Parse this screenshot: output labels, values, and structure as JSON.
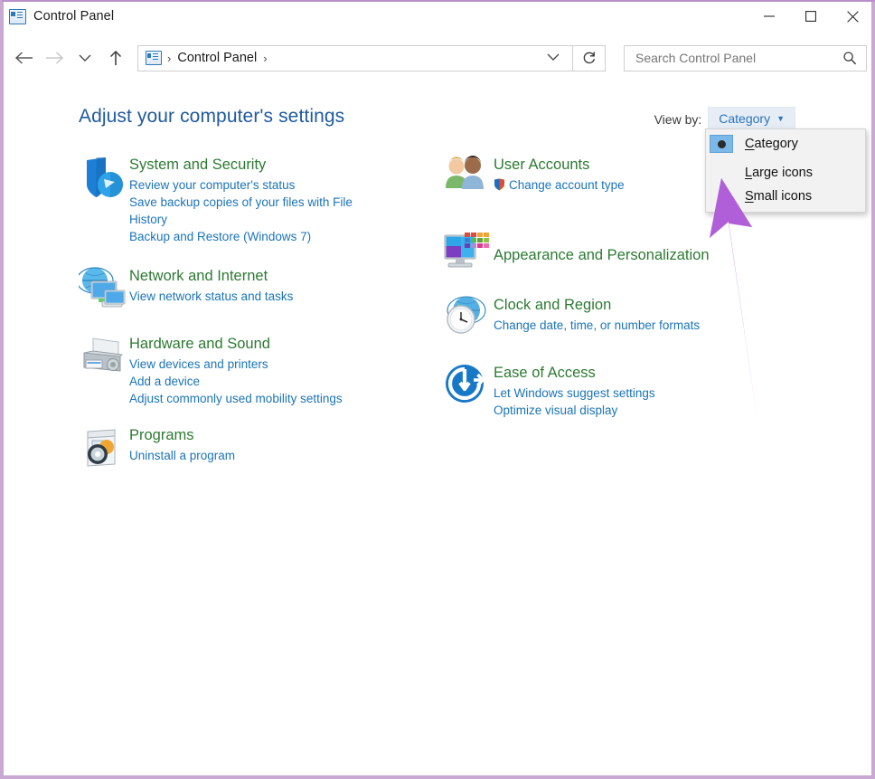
{
  "window": {
    "title": "Control Panel",
    "app_icon": "control-panel-icon",
    "border_color": "#c9a8d4",
    "controls": {
      "minimize": "minimize-icon",
      "maximize": "maximize-icon",
      "close": "close-icon"
    }
  },
  "nav": {
    "back": "back-arrow-icon",
    "forward": "forward-arrow-icon",
    "recent": "chevron-down-icon",
    "up": "up-arrow-icon",
    "refresh": "refresh-icon",
    "breadcrumb_icon": "control-panel-icon",
    "breadcrumb": "Control Panel",
    "separator": "›",
    "dropdown_caret": "chevron-down-icon"
  },
  "search": {
    "placeholder": "Search Control Panel",
    "value": "",
    "icon": "search-icon"
  },
  "main": {
    "page_title": "Adjust your computer's settings",
    "view_by_label": "View by:",
    "view_by_value": "Category",
    "view_by_caret": "caret-down-icon",
    "accent_heading": "#2d7a33",
    "accent_link": "#1b74b8",
    "page_title_color": "#1f5a9e"
  },
  "view_by_menu": {
    "open": true,
    "items": [
      {
        "label": "Category",
        "accel": "C",
        "selected": true
      },
      {
        "label": "Large icons",
        "accel": "L",
        "selected": false
      },
      {
        "label": "Small icons",
        "accel": "S",
        "selected": false
      }
    ]
  },
  "categories_left": [
    {
      "title": "System and Security",
      "icon": "shield-security-icon",
      "links": [
        "Review your computer's status",
        "Save backup copies of your files with File History",
        "Backup and Restore (Windows 7)"
      ]
    },
    {
      "title": "Network and Internet",
      "icon": "network-globe-monitor-icon",
      "links": [
        "View network status and tasks"
      ]
    },
    {
      "title": "Hardware and Sound",
      "icon": "printer-icon",
      "links": [
        "View devices and printers",
        "Add a device",
        "Adjust commonly used mobility settings"
      ]
    },
    {
      "title": "Programs",
      "icon": "programs-disc-icon",
      "links": [
        "Uninstall a program"
      ]
    }
  ],
  "categories_right": [
    {
      "title": "User Accounts",
      "icon": "user-accounts-people-icon",
      "links": [
        {
          "text": "Change account type",
          "shield": true
        }
      ]
    },
    {
      "title": "Appearance and Personalization",
      "icon": "appearance-monitor-palette-icon",
      "links": []
    },
    {
      "title": "Clock and Region",
      "icon": "clock-globe-icon",
      "links": [
        {
          "text": "Change date, time, or number formats",
          "shield": false
        }
      ]
    },
    {
      "title": "Ease of Access",
      "icon": "ease-of-access-icon",
      "links": [
        {
          "text": "Let Windows suggest settings",
          "shield": false
        },
        {
          "text": "Optimize visual display",
          "shield": false
        }
      ]
    }
  ],
  "annotation": {
    "type": "arrow",
    "color": "#b05fd8",
    "points_to": "view-by-dropdown-menu"
  }
}
